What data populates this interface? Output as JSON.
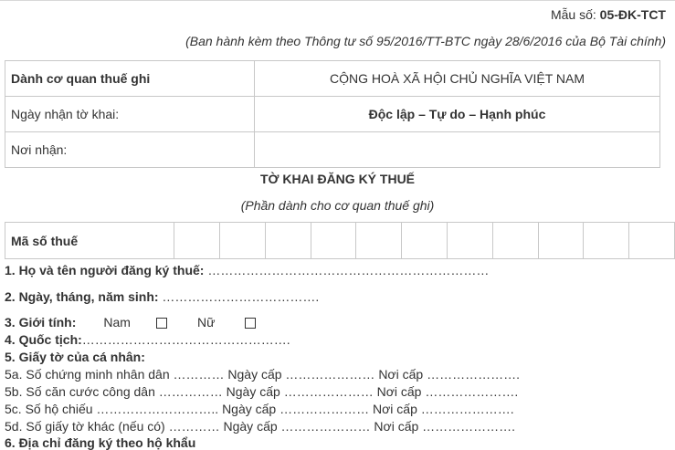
{
  "header": {
    "form_number_prefix": "Mẫu số: ",
    "form_number": "05-ĐK-TCT",
    "issued_by": "(Ban hành kèm theo Thông tư số 95/2016/TT-BTC ngày 28/6/2016 của Bộ Tài chính)"
  },
  "agency_table": {
    "rows": [
      {
        "left": "Dành cơ quan thuế ghi",
        "right": "CỘNG HOÀ XÃ HỘI CHỦ NGHĨA VIỆT NAM"
      },
      {
        "left": "Ngày nhận tờ khai:",
        "right": "Độc lập – Tự do – Hạnh phúc"
      },
      {
        "left": "Nơi nhận:",
        "right": ""
      }
    ]
  },
  "title": "TỜ KHAI ĐĂNG KÝ THUẾ",
  "subtitle": "(Phần dành cho cơ quan thuế ghi)",
  "tax_code_label": "Mã số thuế",
  "fields": {
    "f1_label": "1. Họ và tên người đăng ký thuế:",
    "f1_dots": " …………………………………………………………",
    "f2_label": "2. Ngày, tháng, năm sinh:",
    "f2_dots": " ……………………………….",
    "f3_label": "3. Giới tính:",
    "f3_male": "Nam",
    "f3_female": "Nữ",
    "f4_label": "4. Quốc tịch:",
    "f4_dots": "………………………………………….",
    "f5_label": "5. Giấy tờ của cá nhân:",
    "f5a": "5a. Số chứng minh nhân dân ………… Ngày cấp ………………… Nơi cấp ………………….",
    "f5b": "5b. Số căn cước công dân …………… Ngày cấp ………………… Nơi cấp ………………….",
    "f5c": "5c. Số hộ chiếu ……………………….. Ngày cấp ………………… Nơi cấp ………………….",
    "f5d": "5d. Số giấy tờ khác (nếu có) ………… Ngày cấp ………………… Nơi cấp ………………….",
    "f6_cut": "6. Địa chỉ đăng ký theo hộ khẩu"
  },
  "icons": {
    "checkbox": "empty-checkbox-icon"
  }
}
